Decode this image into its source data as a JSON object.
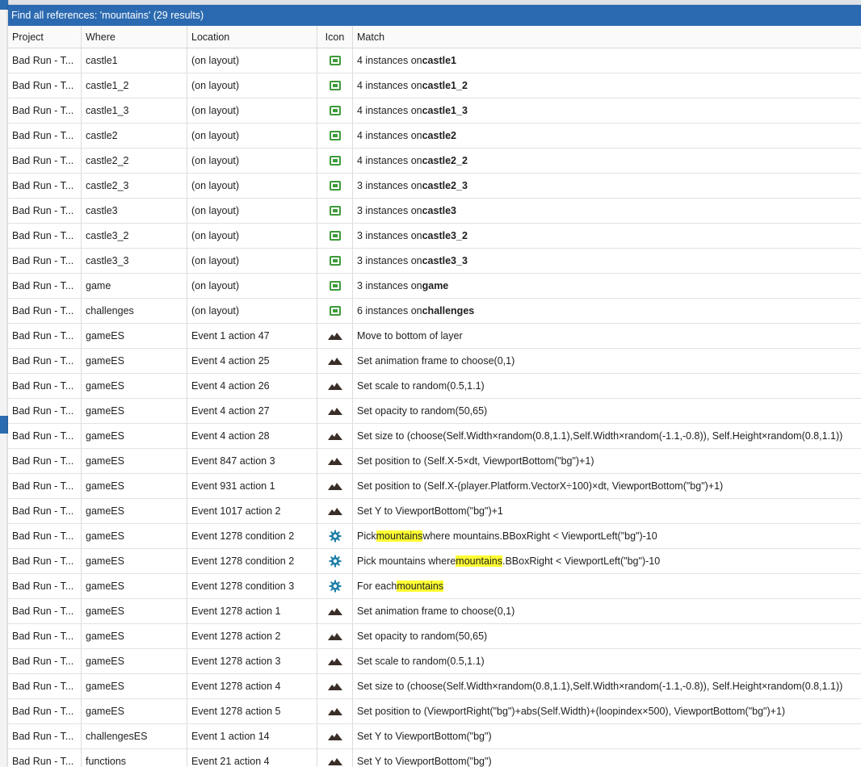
{
  "window": {
    "title": "Find all references: 'mountains' (29 results)"
  },
  "columns": {
    "project": "Project",
    "where": "Where",
    "location": "Location",
    "icon": "Icon",
    "match": "Match"
  },
  "colors": {
    "titlebar": "#2b6ab0",
    "highlight": "#ffff33",
    "layout_icon": "#3e9a3a",
    "gear_icon": "#1f7fa8"
  },
  "rows": [
    {
      "project": "Bad Run - T...",
      "where": "castle1",
      "location": "(on layout)",
      "icon": "layout-icon",
      "match": [
        {
          "t": "4 instances on "
        },
        {
          "t": "castle1",
          "b": true
        }
      ]
    },
    {
      "project": "Bad Run - T...",
      "where": "castle1_2",
      "location": "(on layout)",
      "icon": "layout-icon",
      "match": [
        {
          "t": "4 instances on "
        },
        {
          "t": "castle1_2",
          "b": true
        }
      ]
    },
    {
      "project": "Bad Run - T...",
      "where": "castle1_3",
      "location": "(on layout)",
      "icon": "layout-icon",
      "match": [
        {
          "t": "4 instances on "
        },
        {
          "t": "castle1_3",
          "b": true
        }
      ]
    },
    {
      "project": "Bad Run - T...",
      "where": "castle2",
      "location": "(on layout)",
      "icon": "layout-icon",
      "match": [
        {
          "t": "4 instances on "
        },
        {
          "t": "castle2",
          "b": true
        }
      ]
    },
    {
      "project": "Bad Run - T...",
      "where": "castle2_2",
      "location": "(on layout)",
      "icon": "layout-icon",
      "match": [
        {
          "t": "4 instances on "
        },
        {
          "t": "castle2_2",
          "b": true
        }
      ]
    },
    {
      "project": "Bad Run - T...",
      "where": "castle2_3",
      "location": "(on layout)",
      "icon": "layout-icon",
      "match": [
        {
          "t": "3 instances on "
        },
        {
          "t": "castle2_3",
          "b": true
        }
      ]
    },
    {
      "project": "Bad Run - T...",
      "where": "castle3",
      "location": "(on layout)",
      "icon": "layout-icon",
      "match": [
        {
          "t": "3 instances on "
        },
        {
          "t": "castle3",
          "b": true
        }
      ]
    },
    {
      "project": "Bad Run - T...",
      "where": "castle3_2",
      "location": "(on layout)",
      "icon": "layout-icon",
      "match": [
        {
          "t": "3 instances on "
        },
        {
          "t": "castle3_2",
          "b": true
        }
      ]
    },
    {
      "project": "Bad Run - T...",
      "where": "castle3_3",
      "location": "(on layout)",
      "icon": "layout-icon",
      "match": [
        {
          "t": "3 instances on "
        },
        {
          "t": "castle3_3",
          "b": true
        }
      ]
    },
    {
      "project": "Bad Run - T...",
      "where": "game",
      "location": "(on layout)",
      "icon": "layout-icon",
      "match": [
        {
          "t": "3 instances on "
        },
        {
          "t": "game",
          "b": true
        }
      ]
    },
    {
      "project": "Bad Run - T...",
      "where": "challenges",
      "location": "(on layout)",
      "icon": "layout-icon",
      "match": [
        {
          "t": "6 instances on "
        },
        {
          "t": "challenges",
          "b": true
        }
      ]
    },
    {
      "project": "Bad Run - T...",
      "where": "gameES",
      "location": "Event 1 action 47",
      "icon": "mountain-icon",
      "match": [
        {
          "t": "Move to bottom of layer"
        }
      ]
    },
    {
      "project": "Bad Run - T...",
      "where": "gameES",
      "location": "Event 4 action 25",
      "icon": "mountain-icon",
      "match": [
        {
          "t": "Set animation frame to choose(0,1)"
        }
      ]
    },
    {
      "project": "Bad Run - T...",
      "where": "gameES",
      "location": "Event 4 action 26",
      "icon": "mountain-icon",
      "match": [
        {
          "t": "Set scale to random(0.5,1.1)"
        }
      ]
    },
    {
      "project": "Bad Run - T...",
      "where": "gameES",
      "location": "Event 4 action 27",
      "icon": "mountain-icon",
      "match": [
        {
          "t": "Set opacity to random(50,65)"
        }
      ]
    },
    {
      "project": "Bad Run - T...",
      "where": "gameES",
      "location": "Event 4 action 28",
      "icon": "mountain-icon",
      "match": [
        {
          "t": "Set size to (choose(Self.Width×random(0.8,1.1),Self.Width×random(-1.1,-0.8)), Self.Height×random(0.8,1.1))"
        }
      ]
    },
    {
      "project": "Bad Run - T...",
      "where": "gameES",
      "location": "Event 847 action 3",
      "icon": "mountain-icon",
      "match": [
        {
          "t": "Set position to (Self.X-5×dt, ViewportBottom(\"bg\")+1)"
        }
      ]
    },
    {
      "project": "Bad Run - T...",
      "where": "gameES",
      "location": "Event 931 action 1",
      "icon": "mountain-icon",
      "match": [
        {
          "t": "Set position to (Self.X-(player.Platform.VectorX÷100)×dt, ViewportBottom(\"bg\")+1)"
        }
      ]
    },
    {
      "project": "Bad Run - T...",
      "where": "gameES",
      "location": "Event 1017 action 2",
      "icon": "mountain-icon",
      "match": [
        {
          "t": "Set Y to ViewportBottom(\"bg\")+1"
        }
      ]
    },
    {
      "project": "Bad Run - T...",
      "where": "gameES",
      "location": "Event 1278 condition 2",
      "icon": "gear-icon",
      "match": [
        {
          "t": "Pick "
        },
        {
          "t": "mountains",
          "h": true
        },
        {
          "t": " where mountains.BBoxRight < ViewportLeft(\"bg\")-10"
        }
      ]
    },
    {
      "project": "Bad Run - T...",
      "where": "gameES",
      "location": "Event 1278 condition 2",
      "icon": "gear-icon",
      "match": [
        {
          "t": "Pick mountains where "
        },
        {
          "t": "mountains",
          "h": true
        },
        {
          "t": ".BBoxRight < ViewportLeft(\"bg\")-10"
        }
      ]
    },
    {
      "project": "Bad Run - T...",
      "where": "gameES",
      "location": "Event 1278 condition 3",
      "icon": "gear-icon",
      "match": [
        {
          "t": "For each "
        },
        {
          "t": "mountains",
          "h": true
        }
      ]
    },
    {
      "project": "Bad Run - T...",
      "where": "gameES",
      "location": "Event 1278 action 1",
      "icon": "mountain-icon",
      "match": [
        {
          "t": "Set animation frame to choose(0,1)"
        }
      ]
    },
    {
      "project": "Bad Run - T...",
      "where": "gameES",
      "location": "Event 1278 action 2",
      "icon": "mountain-icon",
      "match": [
        {
          "t": "Set opacity to random(50,65)"
        }
      ]
    },
    {
      "project": "Bad Run - T...",
      "where": "gameES",
      "location": "Event 1278 action 3",
      "icon": "mountain-icon",
      "match": [
        {
          "t": "Set scale to random(0.5,1.1)"
        }
      ]
    },
    {
      "project": "Bad Run - T...",
      "where": "gameES",
      "location": "Event 1278 action 4",
      "icon": "mountain-icon",
      "match": [
        {
          "t": "Set size to (choose(Self.Width×random(0.8,1.1),Self.Width×random(-1.1,-0.8)), Self.Height×random(0.8,1.1))"
        }
      ]
    },
    {
      "project": "Bad Run - T...",
      "where": "gameES",
      "location": "Event 1278 action 5",
      "icon": "mountain-icon",
      "match": [
        {
          "t": "Set position to (ViewportRight(\"bg\")+abs(Self.Width)+(loopindex×500), ViewportBottom(\"bg\")+1)"
        }
      ]
    },
    {
      "project": "Bad Run - T...",
      "where": "challengesES",
      "location": "Event 1 action 14",
      "icon": "mountain-icon",
      "match": [
        {
          "t": "Set Y to ViewportBottom(\"bg\")"
        }
      ]
    },
    {
      "project": "Bad Run - T...",
      "where": "functions",
      "location": "Event 21 action 4",
      "icon": "mountain-icon",
      "match": [
        {
          "t": "Set Y to ViewportBottom(\"bg\")"
        }
      ]
    }
  ]
}
